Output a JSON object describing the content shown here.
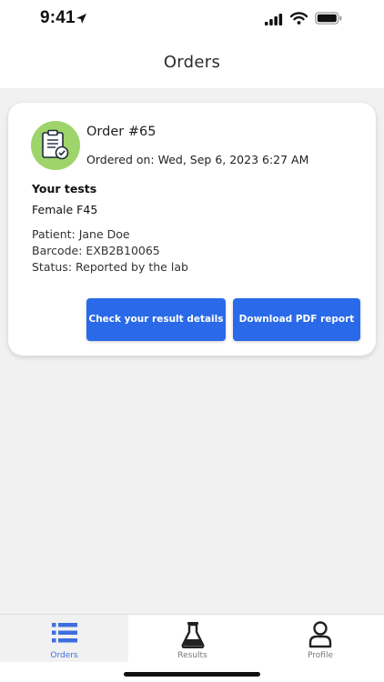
{
  "status_bar": {
    "time": "9:41"
  },
  "header": {
    "title": "Orders"
  },
  "order": {
    "number": "Order #65",
    "ordered_on": "Ordered on: Wed, Sep 6, 2023 6:27 AM",
    "tests_heading": "Your tests",
    "tests": [
      "Female F45"
    ],
    "patient": "Patient: Jane Doe",
    "barcode": "Barcode: EXB2B10065",
    "status": "Status: Reported by the lab",
    "details_button": "Check your result details",
    "pdf_button": "Download PDF report"
  },
  "tabs": [
    {
      "label": "Orders",
      "icon": "list-icon",
      "active": true
    },
    {
      "label": "Results",
      "icon": "flask-icon",
      "active": false
    },
    {
      "label": "Profile",
      "icon": "person-icon",
      "active": false
    }
  ],
  "colors": {
    "accent": "#2a6ae8",
    "order_icon_bg": "#9ed46a",
    "active_tab": "#3d6fe0"
  }
}
